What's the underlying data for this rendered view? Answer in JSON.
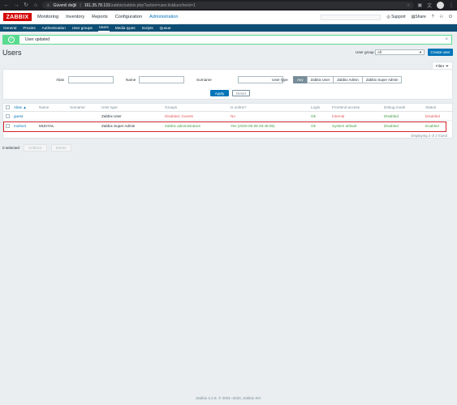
{
  "browser": {
    "insecure_label": "Güvenli değil",
    "url_host": "161.35.78.131",
    "url_path": "/zabbix/zabbix.php?action=user.list&uncheck=1"
  },
  "topbar": {
    "logo": "ZABBIX",
    "menu": [
      "Monitoring",
      "Inventory",
      "Reports",
      "Configuration",
      "Administration"
    ],
    "support": "Support",
    "share": "Share",
    "help": "?"
  },
  "submenu": [
    "General",
    "Proxies",
    "Authentication",
    "User groups",
    "Users",
    "Media types",
    "Scripts",
    "Queue"
  ],
  "message": {
    "text": "User updated",
    "close": "×"
  },
  "page": {
    "title": "Users",
    "user_group_label": "User group",
    "user_group_value": "All",
    "create_button": "Create user",
    "filter_tab": "Filter"
  },
  "filter": {
    "alias_label": "Alias",
    "name_label": "Name",
    "surname_label": "Surname",
    "user_type_label": "User type",
    "user_types": [
      "Any",
      "Zabbix User",
      "Zabbix Admin",
      "Zabbix Super Admin"
    ],
    "apply": "Apply",
    "reset": "Reset"
  },
  "table": {
    "headers": [
      "Alias ▲",
      "Name",
      "Surname",
      "User type",
      "Groups",
      "Is online?",
      "Login",
      "Frontend access",
      "Debug mode",
      "Status"
    ],
    "rows": [
      {
        "alias": "guest",
        "name": "",
        "surname": "",
        "user_type": "Zabbix User",
        "groups": "Disabled, Guests",
        "online": "No",
        "login": "Ok",
        "frontend": "Internal",
        "debug": "Disabled",
        "status": "Disabled"
      },
      {
        "alias": "muhcel",
        "name": "MUHYAL",
        "surname": "",
        "user_type": "Zabbix Super Admin",
        "groups": "Zabbix administrators",
        "online": "Yes (2020-05-08 03:46:05)",
        "login": "Ok",
        "frontend": "System default",
        "debug": "Disabled",
        "status": "Enabled"
      }
    ],
    "displaying": "Displaying 2 of 2 found"
  },
  "footer": {
    "selected": "0 selected",
    "unblock": "Unblock",
    "delete": "Delete",
    "copyright": "Zabbix 4.4.8. © 2001–2020, Zabbix SIA"
  }
}
